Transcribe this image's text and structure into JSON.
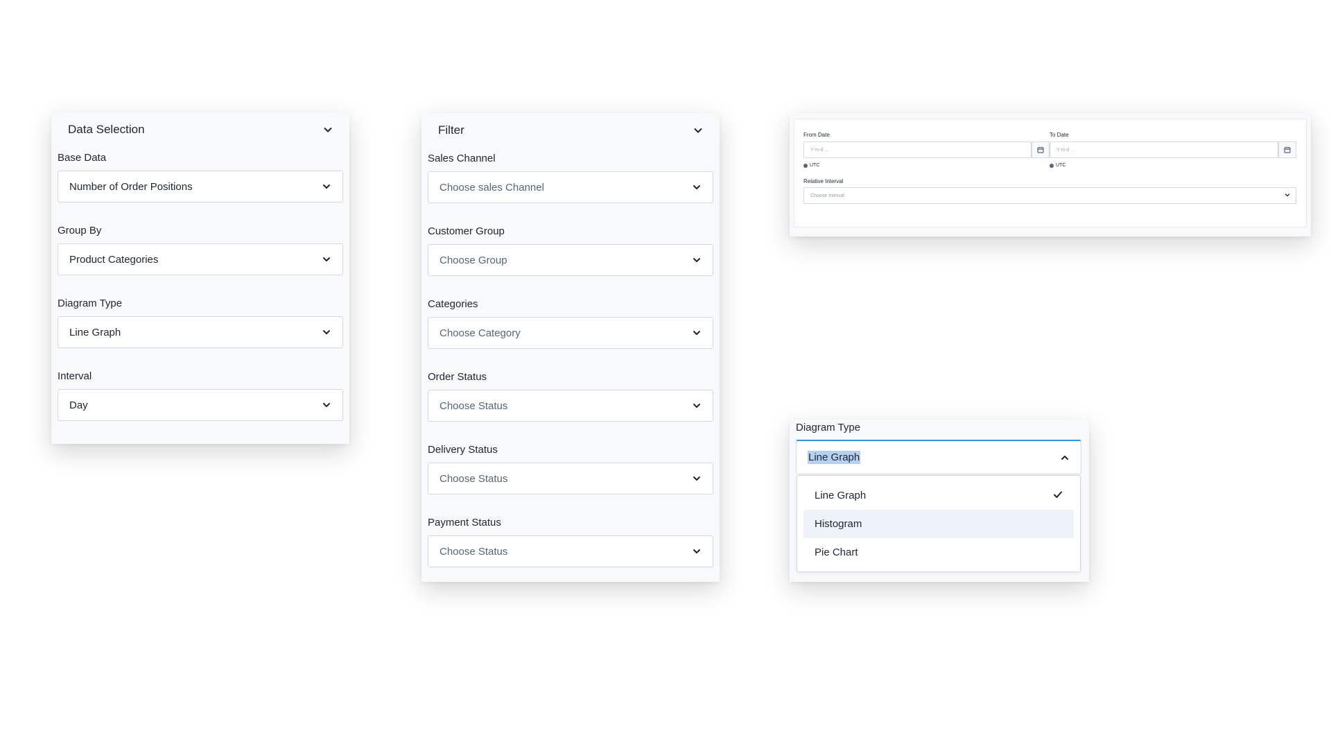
{
  "data_selection": {
    "title": "Data Selection",
    "fields": [
      {
        "label": "Base Data",
        "value": "Number of Order Positions"
      },
      {
        "label": "Group By",
        "value": "Product Categories"
      },
      {
        "label": "Diagram Type",
        "value": "Line Graph"
      },
      {
        "label": "Interval",
        "value": "Day"
      }
    ]
  },
  "filter": {
    "title": "Filter",
    "fields": [
      {
        "label": "Sales Channel",
        "placeholder": "Choose sales Channel"
      },
      {
        "label": "Customer Group",
        "placeholder": "Choose Group"
      },
      {
        "label": "Categories",
        "placeholder": "Choose Category"
      },
      {
        "label": "Order Status",
        "placeholder": "Choose Status"
      },
      {
        "label": "Delivery Status",
        "placeholder": "Choose Status"
      },
      {
        "label": "Payment Status",
        "placeholder": "Choose Status"
      }
    ]
  },
  "date_range": {
    "from_label": "From Date",
    "from_placeholder": "Y-m-d ...",
    "to_label": "To Date",
    "to_placeholder": "Y-m-d ...",
    "timezone": "UTC",
    "relative_label": "Relative Interval",
    "relative_placeholder": "Choose Interval"
  },
  "diagram_dropdown": {
    "label": "Diagram Type",
    "selected": "Line Graph",
    "options": [
      "Line Graph",
      "Histogram",
      "Pie Chart"
    ],
    "hovered_option": "Histogram"
  },
  "colors": {
    "panel_bg": "#f8f9fb",
    "border": "#d1d9e0",
    "focus_accent": "#189eff",
    "selection_highlight": "#b6d1f0",
    "hover_bg": "#eef3fa"
  },
  "icons": {
    "chevron": "chevron-down-icon",
    "chevron_up": "chevron-up-icon",
    "check": "check-icon",
    "calendar": "calendar-icon"
  }
}
